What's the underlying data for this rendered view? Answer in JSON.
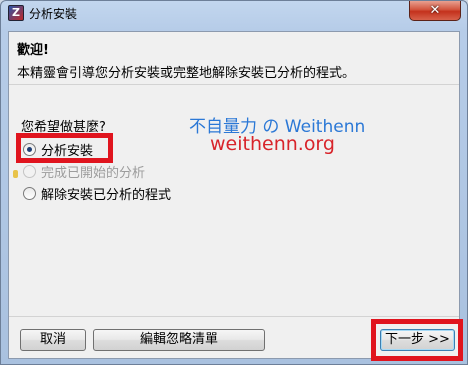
{
  "window": {
    "title": "分析安裝",
    "app_icon": "Z",
    "close_glyph": "✕"
  },
  "welcome": {
    "title": "歡迎!",
    "description": "本精靈會引導您分析安裝或完整地解除安裝已分析的程式。"
  },
  "question": {
    "label": "您希望做甚麼?",
    "options": [
      {
        "label": "分析安裝",
        "checked": true,
        "enabled": true
      },
      {
        "label": "完成已開始的分析",
        "checked": false,
        "enabled": false
      },
      {
        "label": "解除安裝已分析的程式",
        "checked": false,
        "enabled": true
      }
    ]
  },
  "watermark": {
    "line1": "不自量力 の Weithenn",
    "line2": "weithenn.org"
  },
  "buttons": {
    "cancel": "取消",
    "edit_ignore_list": "編輯忽略清單",
    "next": "下一步 >>"
  },
  "colors": {
    "highlight": "#e0141e",
    "watermark_blue": "#2b78d6",
    "watermark_red": "#d8232a"
  }
}
